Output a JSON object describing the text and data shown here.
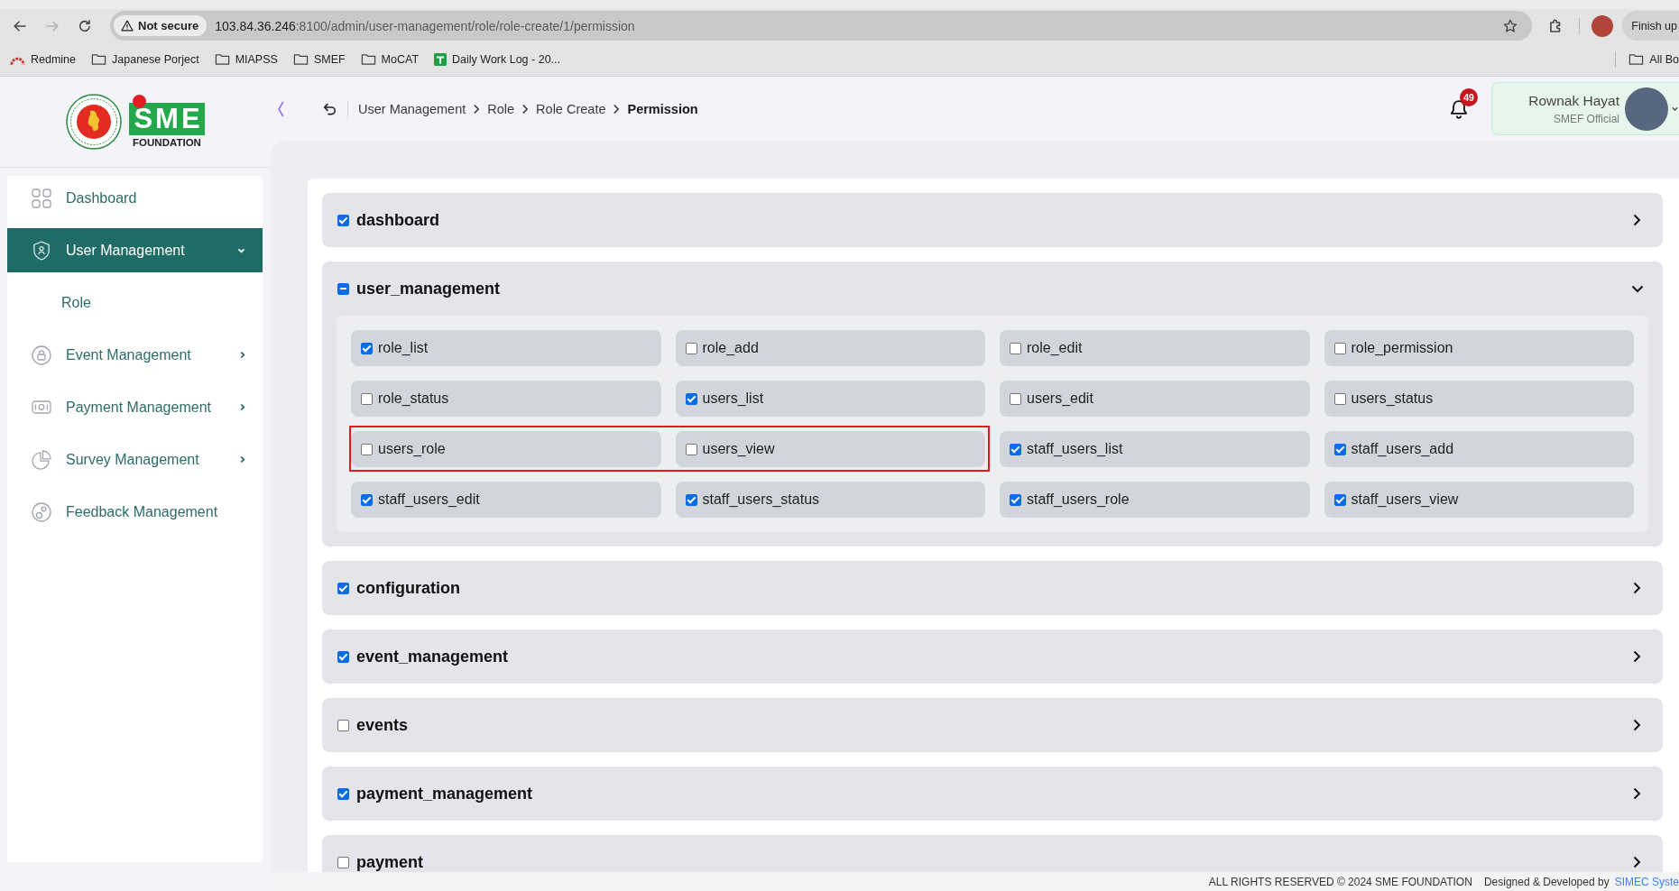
{
  "browser": {
    "forward_disabled": true,
    "security_label": "Not secure",
    "url_host": "103.84.36.246",
    "url_path": ":8100/admin/user-management/role/role-create/1/permission",
    "profile_button": "Finish up"
  },
  "bookmarks": [
    {
      "label": "Redmine",
      "kind": "arc"
    },
    {
      "label": "Japanese Porject",
      "kind": "folder"
    },
    {
      "label": "MIAPSS",
      "kind": "folder"
    },
    {
      "label": "SMEF",
      "kind": "folder"
    },
    {
      "label": "MoCAT",
      "kind": "folder"
    },
    {
      "label": "Daily Work Log - 20...",
      "kind": "sheet"
    }
  ],
  "bookmarks_end": {
    "label": "All Bo"
  },
  "brand": {
    "name": "SME",
    "tagline": "FOUNDATION"
  },
  "sidebar": {
    "items": [
      {
        "label": "Dashboard",
        "kind": "link",
        "selected": false
      },
      {
        "label": "User Management",
        "kind": "group",
        "selected": true,
        "expanded": true,
        "children": [
          {
            "label": "Role",
            "selected": false
          }
        ]
      },
      {
        "label": "Event Management",
        "kind": "group",
        "selected": false,
        "expanded": false
      },
      {
        "label": "Payment Management",
        "kind": "group",
        "selected": false,
        "expanded": false
      },
      {
        "label": "Survey Management",
        "kind": "group",
        "selected": false,
        "expanded": false
      },
      {
        "label": "Feedback Management",
        "kind": "link",
        "selected": false
      }
    ]
  },
  "header": {
    "breadcrumbs": [
      {
        "label": "User Management",
        "current": false
      },
      {
        "label": "Role",
        "current": false
      },
      {
        "label": "Role Create",
        "current": false
      },
      {
        "label": "Permission",
        "current": true
      }
    ],
    "notifications": "49",
    "user": {
      "name": "Rownak Hayat",
      "role": "SMEF Official"
    }
  },
  "sections": [
    {
      "label": "dashboard",
      "checked": true,
      "expanded": false
    },
    {
      "label": "user_management",
      "checked": false,
      "indeterminate": true,
      "expanded": true,
      "permissions": [
        {
          "label": "role_list",
          "checked": true,
          "highlighted": false
        },
        {
          "label": "role_add",
          "checked": false,
          "highlighted": false
        },
        {
          "label": "role_edit",
          "checked": false,
          "highlighted": false
        },
        {
          "label": "role_permission",
          "checked": false,
          "highlighted": false
        },
        {
          "label": "role_status",
          "checked": false,
          "highlighted": false
        },
        {
          "label": "users_list",
          "checked": true,
          "highlighted": false
        },
        {
          "label": "users_edit",
          "checked": false,
          "highlighted": false
        },
        {
          "label": "users_status",
          "checked": false,
          "highlighted": false
        },
        {
          "label": "users_role",
          "checked": false,
          "highlighted": true
        },
        {
          "label": "users_view",
          "checked": false,
          "highlighted": true
        },
        {
          "label": "staff_users_list",
          "checked": true,
          "highlighted": false
        },
        {
          "label": "staff_users_add",
          "checked": true,
          "highlighted": false
        },
        {
          "label": "staff_users_edit",
          "checked": true,
          "highlighted": false
        },
        {
          "label": "staff_users_status",
          "checked": true,
          "highlighted": false
        },
        {
          "label": "staff_users_role",
          "checked": true,
          "highlighted": false
        },
        {
          "label": "staff_users_view",
          "checked": true,
          "highlighted": false
        }
      ]
    },
    {
      "label": "configuration",
      "checked": true,
      "expanded": false
    },
    {
      "label": "event_management",
      "checked": true,
      "expanded": false
    },
    {
      "label": "events",
      "checked": false,
      "expanded": false
    },
    {
      "label": "payment_management",
      "checked": true,
      "expanded": false
    },
    {
      "label": "payment",
      "checked": false,
      "expanded": false
    }
  ],
  "footer": {
    "copyright": "ALL RIGHTS RESERVED © 2024 SME FOUNDATION",
    "credit": "Designed & Developed by",
    "credit_link": "SIMEC Syste"
  }
}
